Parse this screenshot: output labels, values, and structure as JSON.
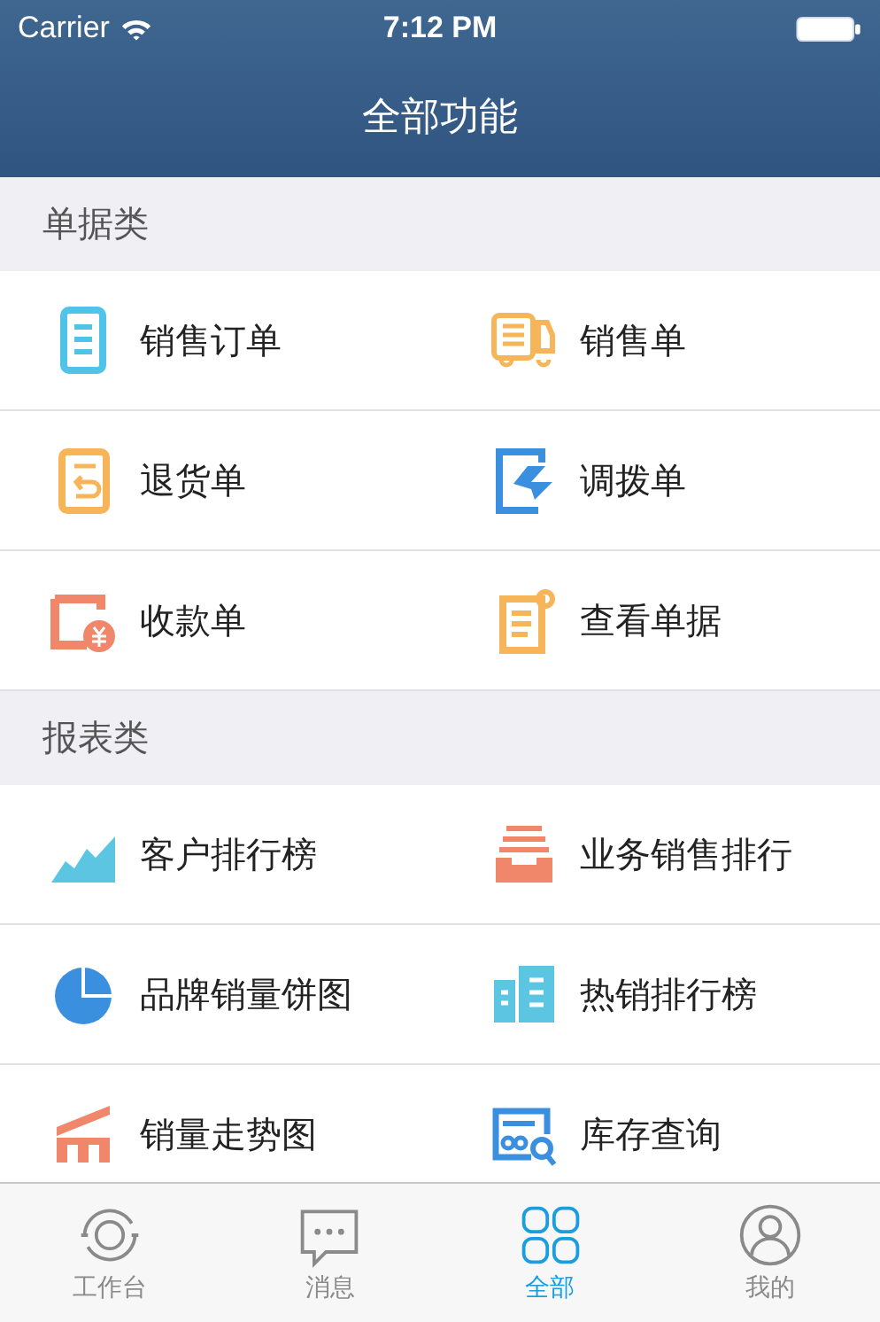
{
  "status_bar": {
    "carrier": "Carrier",
    "time": "7:12 PM"
  },
  "nav_bar": {
    "title": "全部功能"
  },
  "sections": [
    {
      "title": "单据类",
      "items": [
        "销售订单",
        "销售单",
        "退货单",
        "调拨单",
        "收款单",
        "查看单据"
      ]
    },
    {
      "title": "报表类",
      "items": [
        "客户排行榜",
        "业务销售排行",
        "品牌销量饼图",
        "热销排行榜",
        "销量走势图",
        "库存查询"
      ]
    }
  ],
  "tab_bar": [
    {
      "label": "工作台",
      "selected": false
    },
    {
      "label": "消息",
      "selected": false
    },
    {
      "label": "全部",
      "selected": true
    },
    {
      "label": "我的",
      "selected": false
    }
  ]
}
